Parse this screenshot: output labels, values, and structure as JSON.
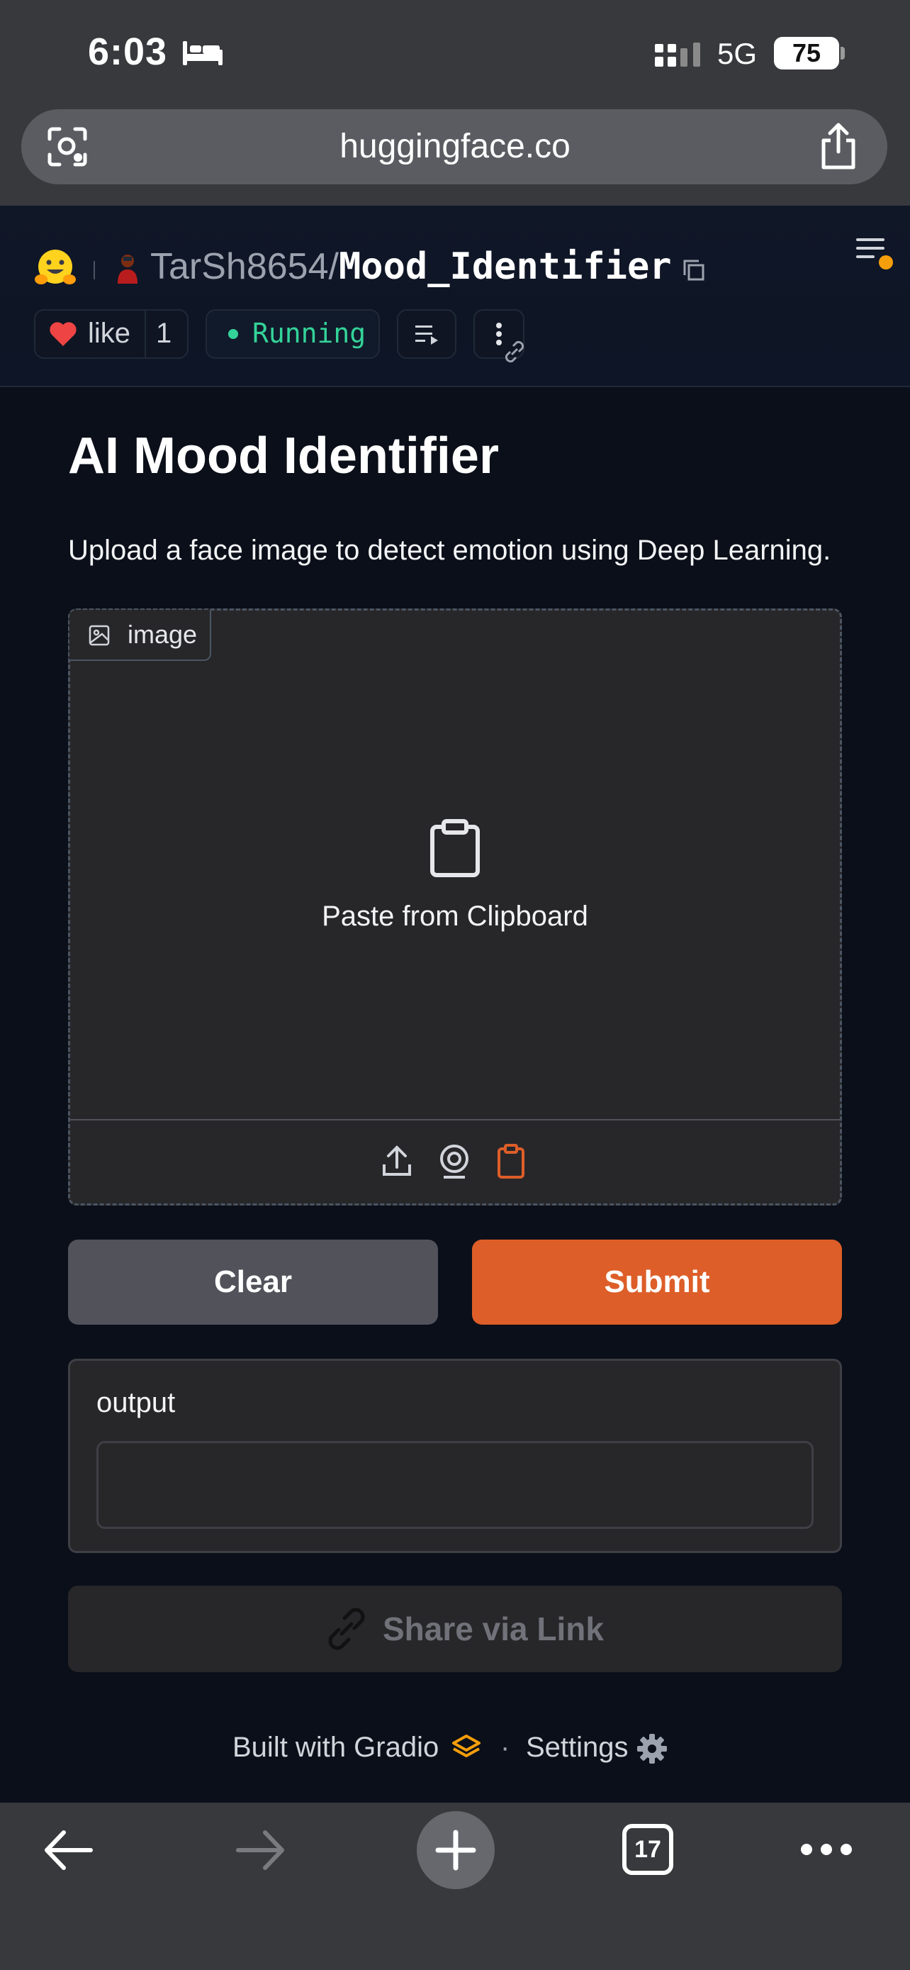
{
  "status_bar": {
    "time": "6:03",
    "network": "5G",
    "battery": "75"
  },
  "browser": {
    "url": "huggingface.co",
    "tab_count": "17"
  },
  "space_header": {
    "owner": "TarSh8654",
    "separator": "/",
    "repo": "Mood_Identifier",
    "like_label": "like",
    "like_count": "1",
    "status": "Running",
    "status_color": "#34d399"
  },
  "app": {
    "title": "AI Mood Identifier",
    "description": "Upload a face image to detect emotion using Deep Learning.",
    "image_input": {
      "label": "image",
      "prompt": "Paste from Clipboard",
      "sources": [
        "upload-icon",
        "webcam-icon",
        "clipboard-icon"
      ],
      "active_source": "clipboard-icon"
    },
    "clear_label": "Clear",
    "submit_label": "Submit",
    "output": {
      "label": "output",
      "value": ""
    },
    "share_label": "Share via Link"
  },
  "footer": {
    "built_with": "Built with Gradio",
    "dot": "·",
    "settings": "Settings"
  },
  "colors": {
    "accent": "#dd5e28",
    "background": "#0b0f19",
    "panel": "#27272a"
  }
}
